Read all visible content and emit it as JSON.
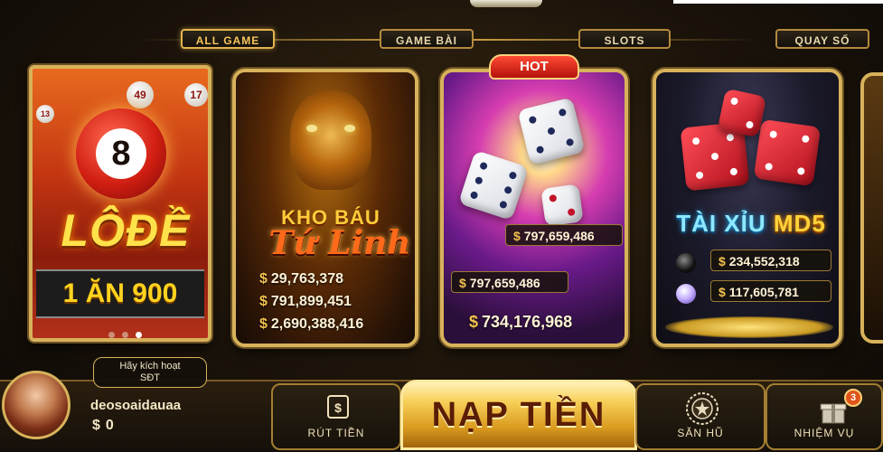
{
  "tabs": [
    "ALL GAME",
    "GAME BÀI",
    "SLOTS",
    "QUAY SỐ"
  ],
  "cards": {
    "lode": {
      "title": "LÔĐỀ",
      "ball_number": "8",
      "small_balls": [
        "49",
        "17",
        "13"
      ],
      "odds": "1 ĂN 900"
    },
    "khobau": {
      "title_line1": "KHO BÁU",
      "title_line2": "Tứ Linh",
      "jackpots": [
        "29,763,378",
        "791,899,451",
        "2,690,388,416"
      ]
    },
    "hot": {
      "badge": "HOT",
      "jackpots": [
        "797,659,486",
        "797,659,486",
        "734,176,968"
      ]
    },
    "taixiu": {
      "title_main": "TÀI XỈU",
      "title_accent": "MD5",
      "jackpots": [
        "234,552,318",
        "117,605,781"
      ]
    }
  },
  "currency_symbol": "$",
  "user": {
    "activate_prompt_line1": "Hãy kích hoạt",
    "activate_prompt_line2": "SĐT",
    "username": "deosoaidauaa",
    "balance": "0"
  },
  "bottom_nav": {
    "withdraw": "RÚT TIỀN",
    "deposit": "NẠP TIỀN",
    "fish_hunt": "SĂN HŨ",
    "missions": "NHIỆM VỤ",
    "missions_badge": "3"
  },
  "icons": {
    "withdraw": "cash-withdraw-icon",
    "fish_hunt": "jackpot-emblem-icon",
    "missions": "gift-box-icon"
  },
  "colors": {
    "gold": "#d7b25b",
    "deposit_text": "#5a1d05",
    "tab_active": "#f6c65b"
  }
}
